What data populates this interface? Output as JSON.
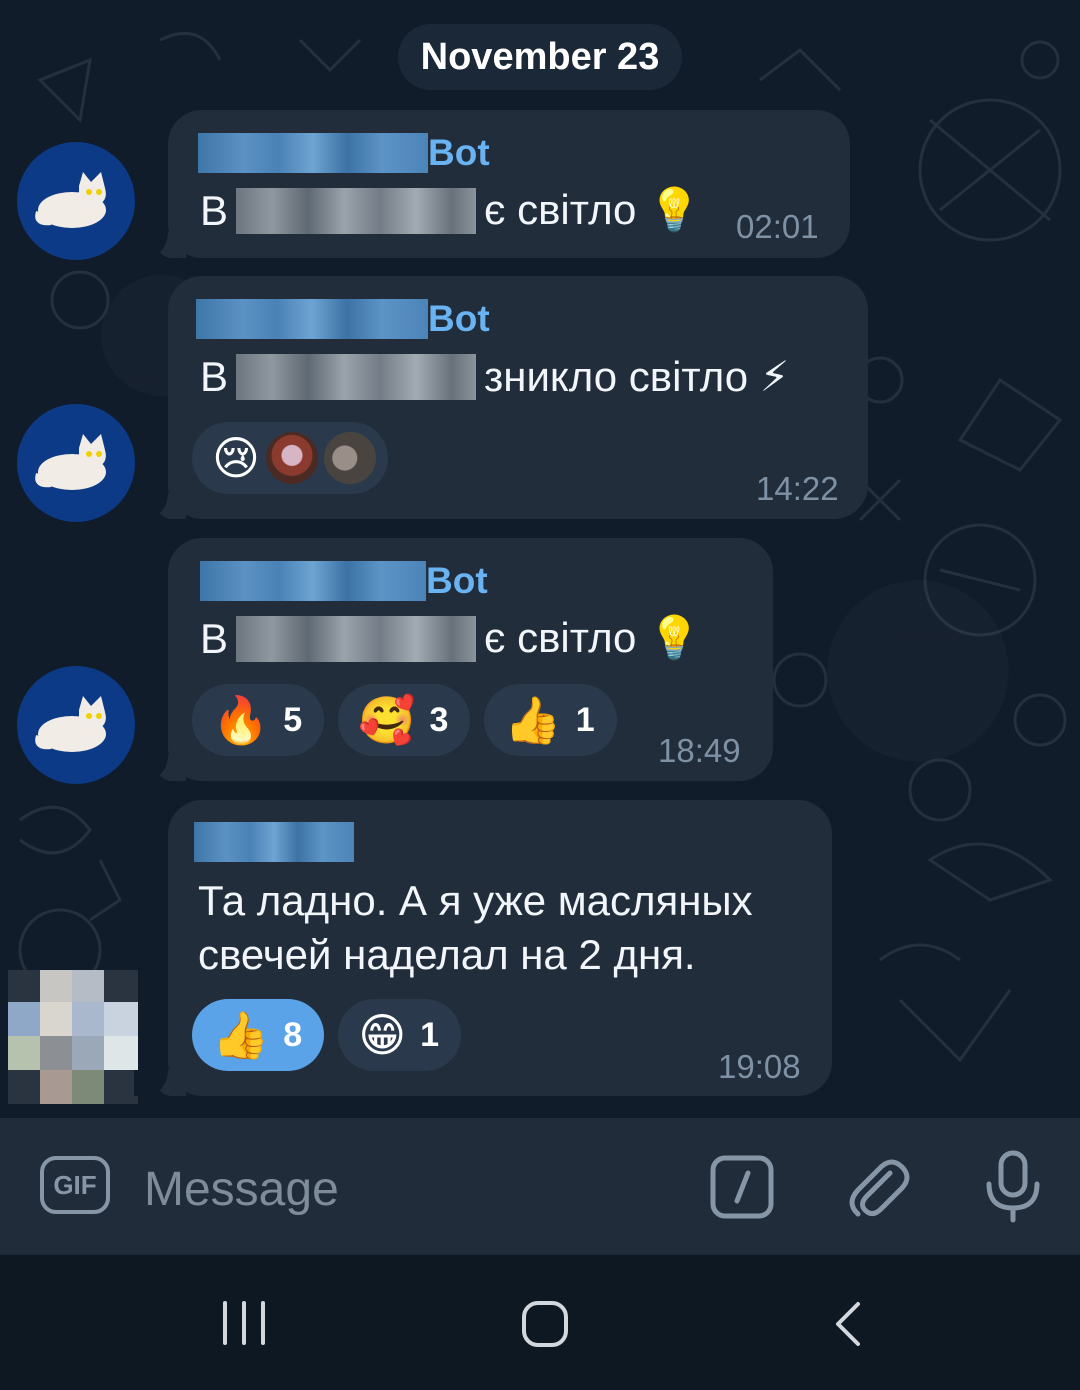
{
  "date_header": "November 23",
  "messages": [
    {
      "sender_suffix": "Bot",
      "text_prefix": "В",
      "text_suffix": "є світло 💡",
      "time": "02:01",
      "reactions": []
    },
    {
      "sender_suffix": "Bot",
      "text_prefix": "В",
      "text_suffix": "зникло світло ⚡",
      "time": "14:22",
      "reactions": [
        {
          "emoji": "😢",
          "count": ""
        }
      ]
    },
    {
      "sender_suffix": "Bot",
      "text_prefix": "В",
      "text_suffix": "є світло 💡",
      "time": "18:49",
      "reactions": [
        {
          "emoji": "🔥",
          "count": "5"
        },
        {
          "emoji": "🥰",
          "count": "3"
        },
        {
          "emoji": "👍",
          "count": "1"
        }
      ]
    },
    {
      "text_line1": "Та ладно. А я уже масляных",
      "text_line2": "свечей наделал на 2 дня.",
      "time": "19:08",
      "reactions": [
        {
          "emoji": "👍",
          "count": "8",
          "chosen": true
        },
        {
          "emoji": "😁",
          "count": "1"
        }
      ]
    }
  ],
  "input": {
    "gif_label": "GIF",
    "placeholder": "Message"
  },
  "icons": {
    "gif": "gif-icon",
    "bot_commands": "slash-command-icon",
    "attach": "paperclip-icon",
    "mic": "microphone-icon",
    "nav_recents": "recents-icon",
    "nav_home": "home-icon",
    "nav_back": "back-icon"
  },
  "colors": {
    "background": "#111c2a",
    "bubble": "#212d3b",
    "sender_name": "#6ab3f3",
    "time_text": "#7f91a4",
    "reaction_bg": "#2a3a4c",
    "reaction_chosen_bg": "#5aa3e8"
  }
}
